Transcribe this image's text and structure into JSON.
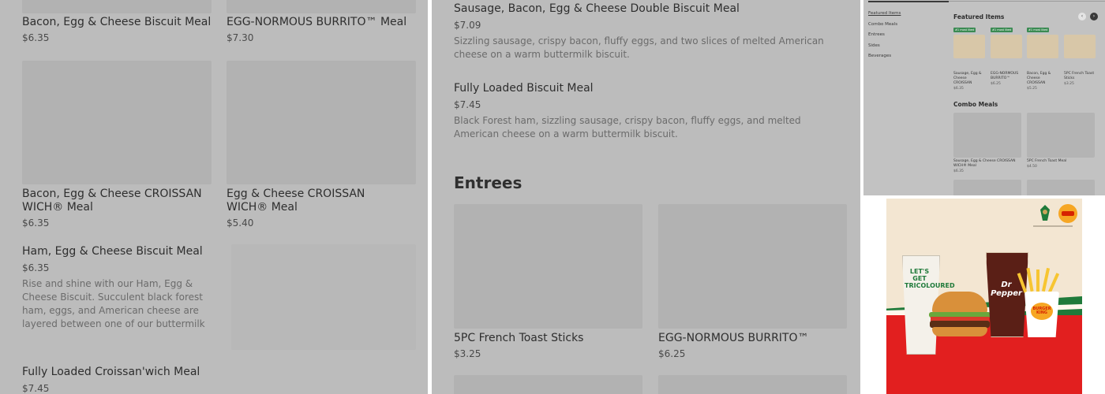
{
  "panel1": {
    "items": [
      {
        "title": "Bacon, Egg & Cheese Biscuit Meal",
        "price": "$6.35"
      },
      {
        "title": "EGG-NORMOUS BURRITO™ Meal",
        "price": "$7.30"
      },
      {
        "title": "Bacon, Egg & Cheese CROISSAN WICH® Meal",
        "price": "$6.35"
      },
      {
        "title": "Egg & Cheese CROISSAN WICH® Meal",
        "price": "$5.40"
      },
      {
        "title": "Ham, Egg & Cheese Biscuit Meal",
        "price": "$6.35",
        "desc": "Rise and shine with our Ham, Egg & Cheese Biscuit. Succulent black forest ham, eggs, and American cheese are layered between one of our buttermilk biscuits. Meal comes in mediu…"
      },
      {
        "title": "Fully Loaded Croissan'wich Meal",
        "price": "$7.45"
      }
    ]
  },
  "panel2": {
    "items": [
      {
        "title": "Sausage, Bacon, Egg & Cheese Double Biscuit Meal",
        "price": "$7.09",
        "desc": "Sizzling sausage, crispy bacon, fluffy eggs, and two slices of melted American cheese on a warm buttermilk biscuit."
      },
      {
        "title": "Fully Loaded Biscuit Meal",
        "price": "$7.45",
        "desc": "Black Forest ham, sizzling sausage, crispy bacon, fluffy eggs, and melted American cheese on a warm buttermilk biscuit."
      }
    ],
    "section": "Entrees",
    "entrees": [
      {
        "title": "5PC French Toast Sticks",
        "price": "$3.25"
      },
      {
        "title": "EGG-NORMOUS BURRITO™",
        "price": "$6.25"
      }
    ]
  },
  "panel3": {
    "sidebar": [
      "Featured Items",
      "Combo Meals",
      "Entrees",
      "Sides",
      "Beverages"
    ],
    "featured_header": "Featured Items",
    "badge": "#1 most liked",
    "featured": [
      {
        "name": "Sausage, Egg & Cheese CROISSAN",
        "price": "$6.35"
      },
      {
        "name": "EGG-NORMOUS BURRITO™",
        "price": "$6.25"
      },
      {
        "name": "Bacon, Egg & Cheese CROISSAN",
        "price": "$5.25"
      },
      {
        "name": "5PC French Toast Sticks",
        "price": "$3.25"
      }
    ],
    "combo_header": "Combo Meals",
    "combos": [
      {
        "name": "Sausage, Egg & Cheese CROISSAN WICH® Meal",
        "price": "$6.35"
      },
      {
        "name": "5PC French Toast Meal",
        "price": "$4.50"
      }
    ]
  },
  "panel4": {
    "tagline": "LET'S GET TRICOLOURED",
    "brand": "BURGER KING",
    "drink": "Dr Pepper",
    "colors": {
      "red": "#e21f1f",
      "green": "#1f7a3a",
      "cream": "#f3e6d2"
    }
  }
}
